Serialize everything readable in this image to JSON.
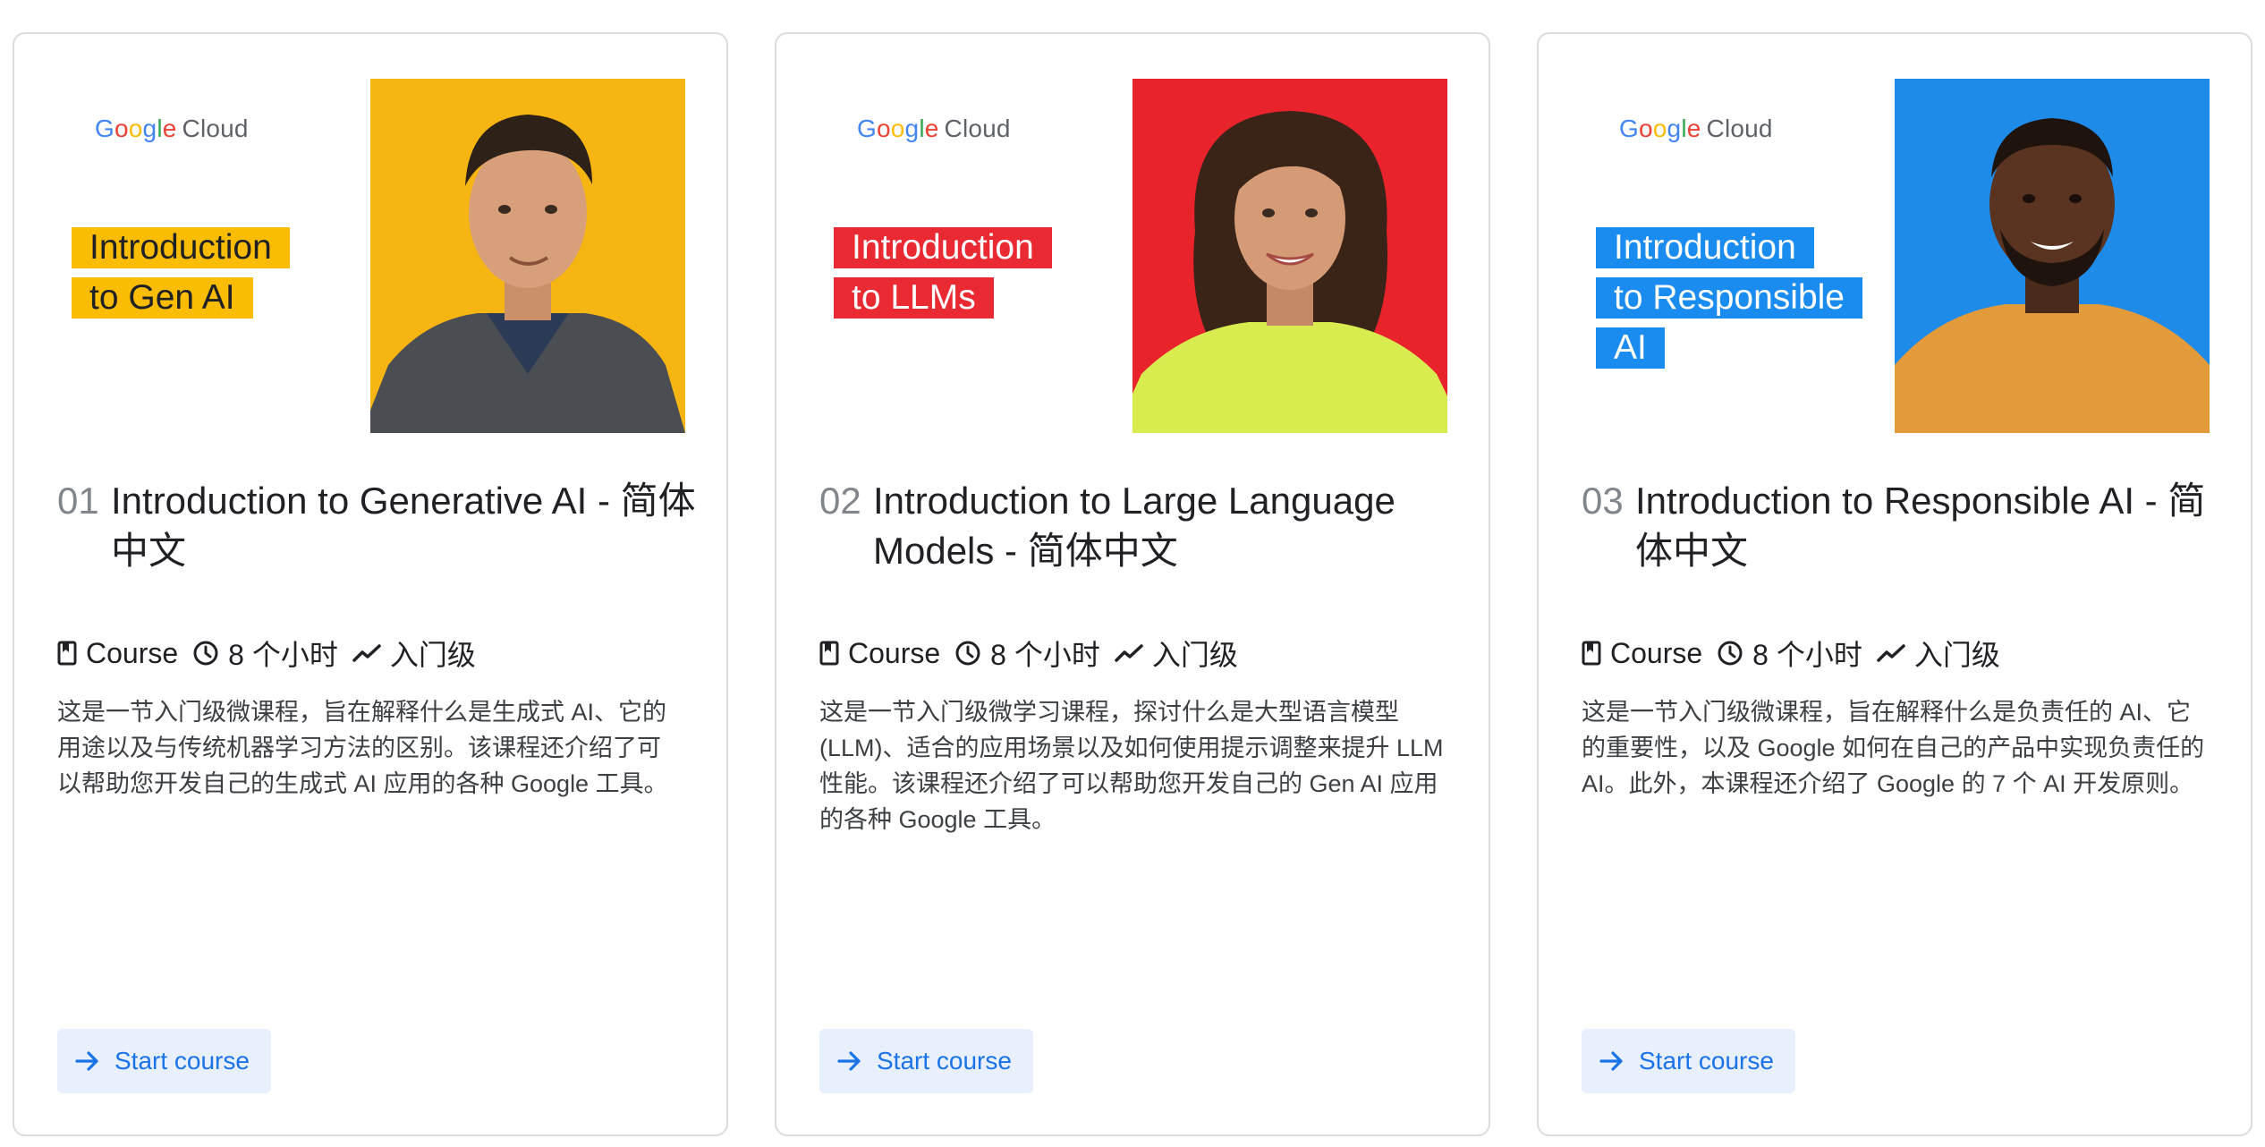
{
  "courses": [
    {
      "number": "01",
      "title": "Introduction to Generative AI - 简体中文",
      "banner_line1": "Introduction",
      "banner_line2": "to Gen AI",
      "banner_line3": "",
      "banner_color": "#FBBC04",
      "type": "Course",
      "duration": "8 个小时",
      "level": "入门级",
      "description": "这是一节入门级微课程，旨在解释什么是生成式 AI、它的用途以及与传统机器学习方法的区别。该课程还介绍了可以帮助您开发自己的生成式 AI 应用的各种 Google 工具。",
      "button_label": "Start course"
    },
    {
      "number": "02",
      "title": "Introduction to Large Language Models - 简体中文",
      "banner_line1": "Introduction",
      "banner_line2": "to LLMs",
      "banner_line3": "",
      "banner_color": "#EA2A33",
      "type": "Course",
      "duration": "8 个小时",
      "level": "入门级",
      "description": "这是一节入门级微学习课程，探讨什么是大型语言模型 (LLM)、适合的应用场景以及如何使用提示调整来提升 LLM 性能。该课程还介绍了可以帮助您开发自己的 Gen AI 应用的各种 Google 工具。",
      "button_label": "Start course"
    },
    {
      "number": "03",
      "title": "Introduction to Responsible AI - 简体中文",
      "banner_line1": "Introduction",
      "banner_line2": "to Responsible",
      "banner_line3": "AI",
      "banner_color": "#1A8CF0",
      "type": "Course",
      "duration": "8 个小时",
      "level": "入门级",
      "description": "这是一节入门级微课程，旨在解释什么是负责任的 AI、它的重要性，以及 Google 如何在自己的产品中实现负责任的 AI。此外，本课程还介绍了 Google 的 7 个 AI 开发原则。",
      "button_label": "Start course"
    }
  ],
  "logo": {
    "g1": "G",
    "g2": "o",
    "g3": "o",
    "g4": "g",
    "g5": "l",
    "g6": "e",
    "cloud": "Cloud"
  }
}
